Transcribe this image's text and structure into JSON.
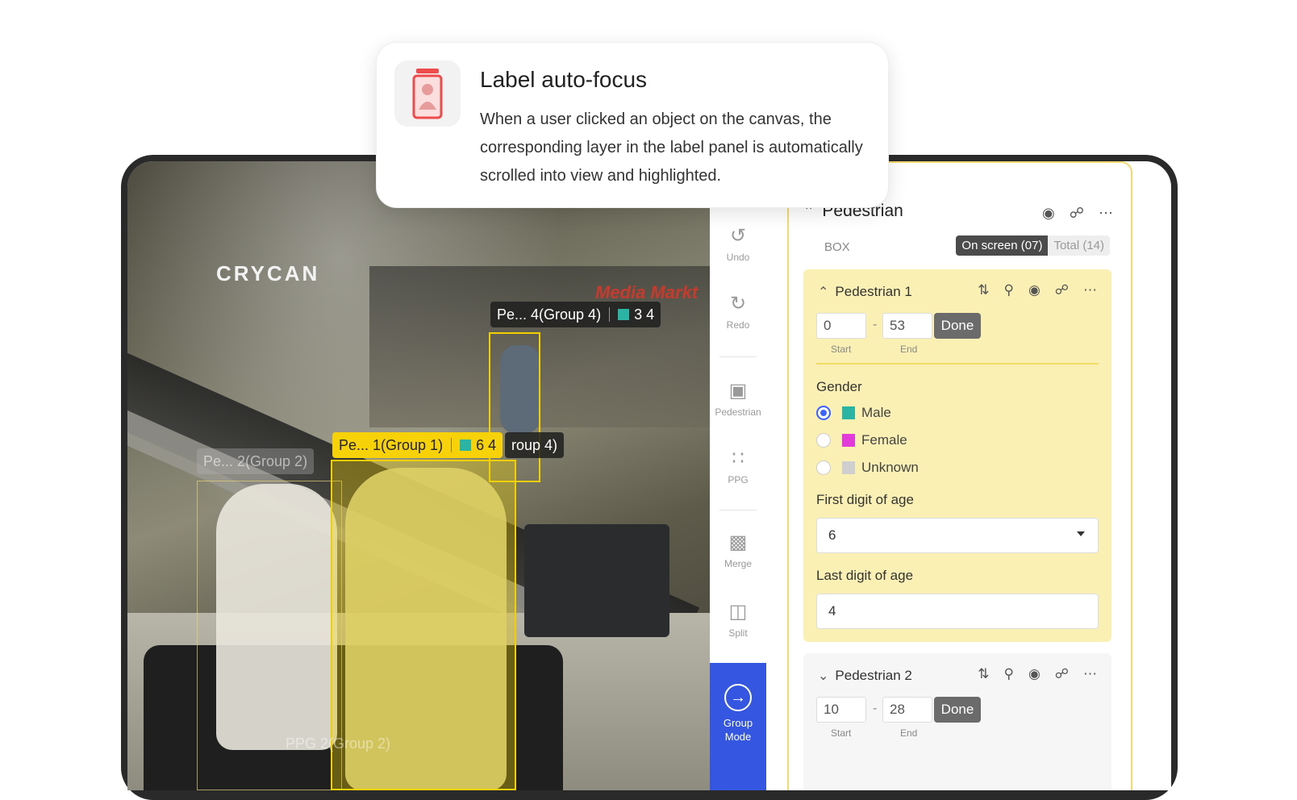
{
  "popup": {
    "title": "Label auto-focus",
    "description": "When a user clicked an object on the canvas, the corresponding layer in the label panel is automatically scrolled into view and highlighted."
  },
  "canvas": {
    "store_sign": "CRYCAN",
    "store_sign2": "Media Markt",
    "tags": {
      "group4": {
        "label": "Pe... 4(Group 4)",
        "value": "3 4"
      },
      "group4_partial": {
        "label": "roup 4)"
      },
      "group1": {
        "label": "Pe... 1(Group 1)",
        "value": "6 4"
      },
      "group2": {
        "label": "Pe... 2(Group 2)"
      },
      "ppg2": {
        "label": "PPG 2(Group 2)"
      }
    }
  },
  "toolbar": {
    "undo": "Undo",
    "redo": "Redo",
    "pedestrian": "Pedestrian",
    "ppg": "PPG",
    "merge": "Merge",
    "split": "Split",
    "group_mode": "Group Mode"
  },
  "panel": {
    "title": "Pedestrian",
    "box_label": "BOX",
    "on_screen": "On screen (07)",
    "total": "Total (14)",
    "cards": [
      {
        "title": "Pedestrian 1",
        "start": "0",
        "end": "53",
        "done": "Done",
        "start_label": "Start",
        "end_label": "End",
        "gender_label": "Gender",
        "options": [
          {
            "label": "Male",
            "color": "#2bb3a3",
            "selected": true
          },
          {
            "label": "Female",
            "color": "#e23bd9",
            "selected": false
          },
          {
            "label": "Unknown",
            "color": "#cfcfcf",
            "selected": false
          }
        ],
        "first_digit_label": "First digit of age",
        "first_digit_value": "6",
        "last_digit_label": "Last digit of age",
        "last_digit_value": "4"
      },
      {
        "title": "Pedestrian 2",
        "start": "10",
        "end": "28",
        "done": "Done",
        "start_label": "Start",
        "end_label": "End"
      }
    ]
  },
  "colors": {
    "accent": "#3556e0",
    "highlight": "#f7d208",
    "panel_bg": "#fbf0b3"
  }
}
